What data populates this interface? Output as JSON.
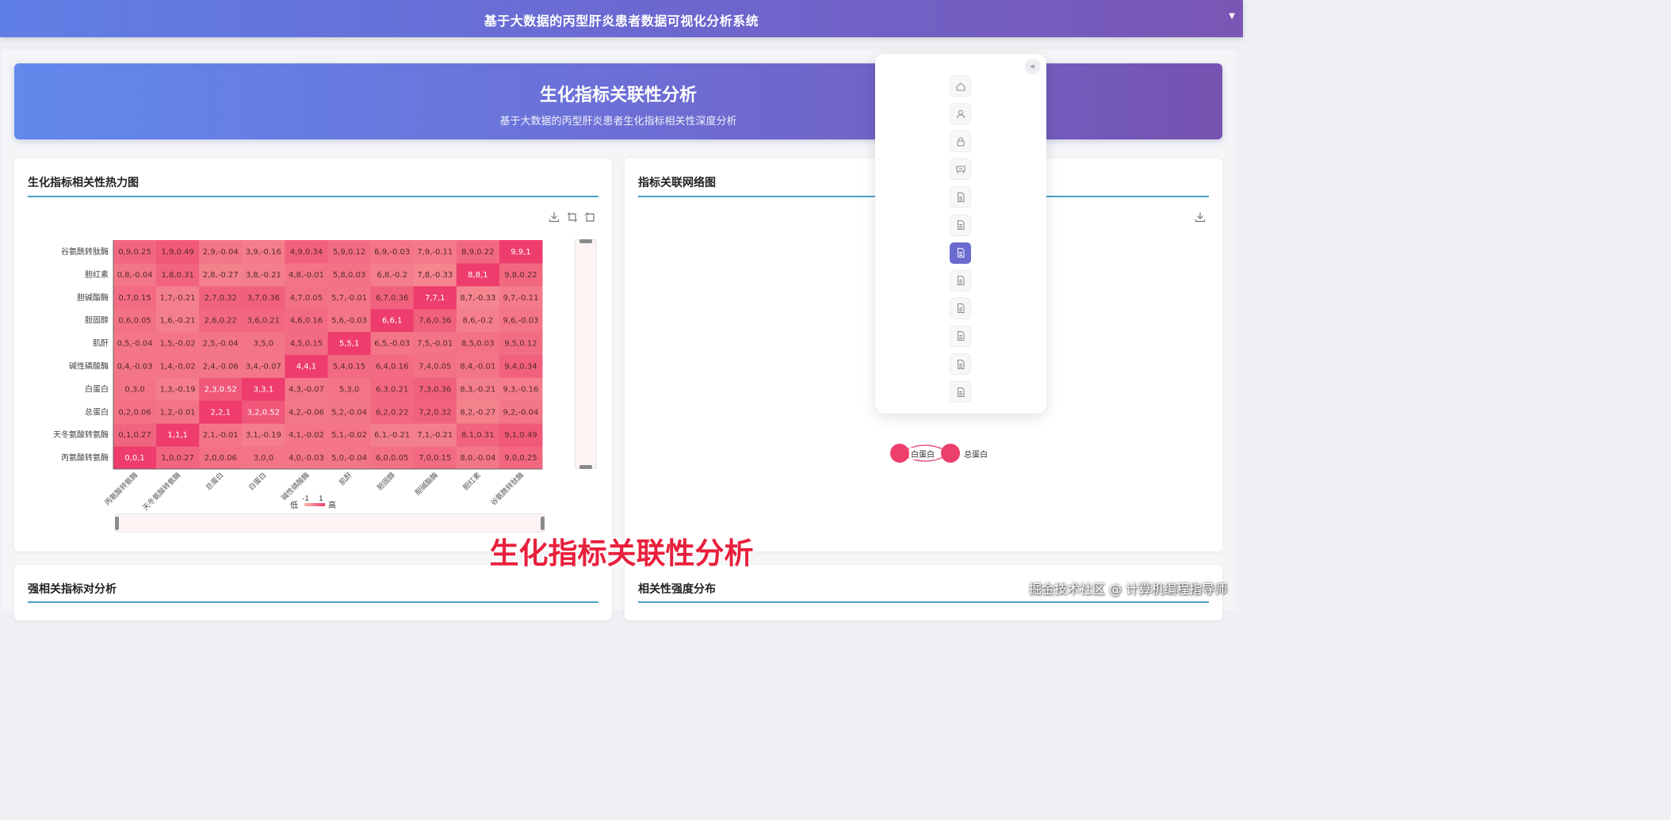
{
  "app": {
    "title": "基于大数据的丙型肝炎患者数据可视化分析系统"
  },
  "hero": {
    "title": "生化指标关联性分析",
    "subtitle": "基于大数据的丙型肝炎患者生化指标相关性深度分析"
  },
  "cards": {
    "heatmap": {
      "title": "生化指标相关性热力图"
    },
    "network": {
      "title": "指标关联网络图",
      "node_label_1": "白蛋白",
      "node_label_2": "总蛋白"
    },
    "strong_pairs": {
      "title": "强相关指标对分析"
    },
    "distribution": {
      "title": "相关性强度分布"
    }
  },
  "toolbox": {
    "download_icon": "download-icon",
    "zoom_icon": "data-zoom-icon",
    "reset_icon": "zoom-reset-icon"
  },
  "sidebar_menu": {
    "collapse_label": "«",
    "items": [
      {
        "icon": "home-icon"
      },
      {
        "icon": "user-icon"
      },
      {
        "icon": "lock-icon"
      },
      {
        "icon": "presentation-icon"
      },
      {
        "icon": "document-icon"
      },
      {
        "icon": "document-icon"
      },
      {
        "icon": "document-icon",
        "active": true
      },
      {
        "icon": "document-icon"
      },
      {
        "icon": "document-icon"
      },
      {
        "icon": "document-icon"
      },
      {
        "icon": "document-icon"
      },
      {
        "icon": "document-icon"
      }
    ]
  },
  "caption": "生化指标关联性分析",
  "watermark": "掘金技术社区 @ 计算机编程指导师",
  "colors": {
    "accent": "#6a6bcf",
    "title_underline": "#4aa0c8",
    "heat_high": "#ee3d6d",
    "heat_low": "#f8aaa0"
  },
  "chart_data": {
    "type": "heatmap",
    "x_categories": [
      "丙氨酸转氨酶",
      "天冬氨酸转氨酶",
      "总蛋白",
      "白蛋白",
      "碱性磷酸酶",
      "肌酐",
      "胆固醇",
      "胆碱酯酶",
      "胆红素",
      "谷氨酰转肽酶"
    ],
    "y_categories": [
      "丙氨酸转氨酶",
      "天冬氨酸转氨酶",
      "总蛋白",
      "白蛋白",
      "碱性磷酸酶",
      "肌酐",
      "胆固醇",
      "胆碱酯酶",
      "胆红素",
      "谷氨酰转肽酶"
    ],
    "cells": [
      [
        "0,0,1",
        "1,0,0.27",
        "2,0,0.06",
        "3,0,0",
        "4,0,-0.03",
        "5,0,-0.04",
        "6,0,0.05",
        "7,0,0.15",
        "8,0,-0.04",
        "9,0,0.25"
      ],
      [
        "0,1,0.27",
        "1,1,1",
        "2,1,-0.01",
        "3,1,-0.19",
        "4,1,-0.02",
        "5,1,-0.02",
        "6,1,-0.21",
        "7,1,-0.21",
        "8,1,0.31",
        "9,1,0.49"
      ],
      [
        "0,2,0.06",
        "1,2,-0.01",
        "2,2,1",
        "3,2,0.52",
        "4,2,-0.06",
        "5,2,-0.04",
        "6,2,0.22",
        "7,2,0.32",
        "8,2,-0.27",
        "9,2,-0.04"
      ],
      [
        "0,3,0",
        "1,3,-0.19",
        "2,3,0.52",
        "3,3,1",
        "4,3,-0.07",
        "5,3,0",
        "6,3,0.21",
        "7,3,0.36",
        "8,3,-0.21",
        "9,3,-0.16"
      ],
      [
        "0,4,-0.03",
        "1,4,-0.02",
        "2,4,-0.06",
        "3,4,-0.07",
        "4,4,1",
        "5,4,0.15",
        "6,4,0.16",
        "7,4,0.05",
        "8,4,-0.01",
        "9,4,0.34"
      ],
      [
        "0,5,-0.04",
        "1,5,-0.02",
        "2,5,-0.04",
        "3,5,0",
        "4,5,0.15",
        "5,5,1",
        "6,5,-0.03",
        "7,5,-0.01",
        "8,5,0.03",
        "9,5,0.12"
      ],
      [
        "0,6,0.05",
        "1,6,-0.21",
        "2,6,0.22",
        "3,6,0.21",
        "4,6,0.16",
        "5,6,-0.03",
        "6,6,1",
        "7,6,0.36",
        "8,6,-0.2",
        "9,6,-0.03"
      ],
      [
        "0,7,0.15",
        "1,7,-0.21",
        "2,7,0.32",
        "3,7,0.36",
        "4,7,0.05",
        "5,7,-0.01",
        "6,7,0.36",
        "7,7,1",
        "8,7,-0.33",
        "9,7,-0.11"
      ],
      [
        "0,8,-0.04",
        "1,8,0.31",
        "2,8,-0.27",
        "3,8,-0.21",
        "4,8,-0.01",
        "5,8,0.03",
        "6,8,-0.2",
        "7,8,-0.33",
        "8,8,1",
        "9,8,0.22"
      ],
      [
        "0,9,0.25",
        "1,9,0.49",
        "2,9,-0.04",
        "3,9,-0.16",
        "4,9,0.34",
        "5,9,0.12",
        "6,9,-0.03",
        "7,9,-0.11",
        "8,9,0.22",
        "9,9,1"
      ]
    ],
    "values": [
      [
        1,
        0.27,
        0.06,
        0,
        -0.03,
        -0.04,
        0.05,
        0.15,
        -0.04,
        0.25
      ],
      [
        0.27,
        1,
        -0.01,
        -0.19,
        -0.02,
        -0.02,
        -0.21,
        -0.21,
        0.31,
        0.49
      ],
      [
        0.06,
        -0.01,
        1,
        0.52,
        -0.06,
        -0.04,
        0.22,
        0.32,
        -0.27,
        -0.04
      ],
      [
        0,
        -0.19,
        0.52,
        1,
        -0.07,
        0,
        0.21,
        0.36,
        -0.21,
        -0.16
      ],
      [
        -0.03,
        -0.02,
        -0.06,
        -0.07,
        1,
        0.15,
        0.16,
        0.05,
        -0.01,
        0.34
      ],
      [
        -0.04,
        -0.02,
        -0.04,
        0,
        0.15,
        1,
        -0.03,
        -0.01,
        0.03,
        0.12
      ],
      [
        0.05,
        -0.21,
        0.22,
        0.21,
        0.16,
        -0.03,
        1,
        0.36,
        -0.2,
        -0.03
      ],
      [
        0.15,
        -0.21,
        0.32,
        0.36,
        0.05,
        -0.01,
        0.36,
        1,
        -0.33,
        -0.11
      ],
      [
        -0.04,
        0.31,
        -0.27,
        -0.21,
        -0.01,
        0.03,
        -0.2,
        -0.33,
        1,
        0.22
      ],
      [
        0.25,
        0.49,
        -0.04,
        -0.16,
        0.34,
        0.12,
        -0.03,
        -0.11,
        0.22,
        1
      ]
    ],
    "visualmap": {
      "low_label": "低",
      "high_label": "高",
      "min_label": "-1",
      "max_label": "1",
      "range": [
        -1,
        1
      ]
    }
  }
}
